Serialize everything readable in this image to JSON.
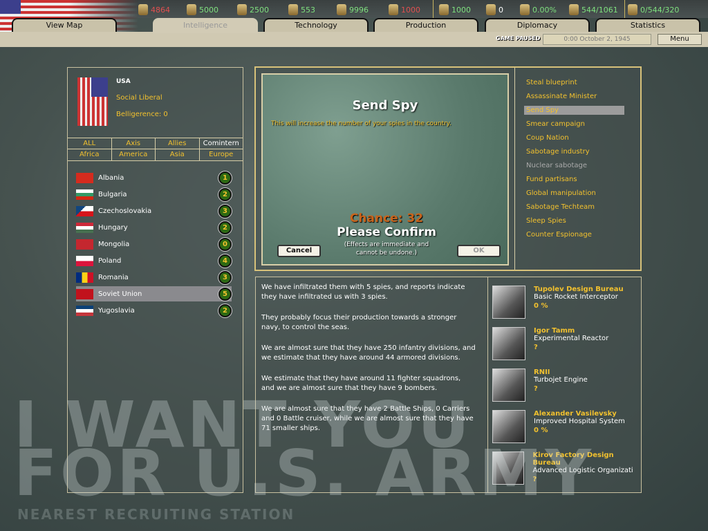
{
  "resources": [
    {
      "icon": "energy-icon",
      "value": "4864",
      "color": "#e05050"
    },
    {
      "icon": "metal-icon",
      "value": "5000",
      "color": "#7ee07e"
    },
    {
      "icon": "rare-materials-icon",
      "value": "2500",
      "color": "#7ee07e"
    },
    {
      "icon": "oil-icon",
      "value": "553",
      "color": "#7ee07e"
    },
    {
      "icon": "supplies-icon",
      "value": "9996",
      "color": "#7ee07e"
    },
    {
      "icon": "money-icon",
      "value": "1000",
      "color": "#e05050"
    },
    {
      "icon": "manpower-icon",
      "value": "1000",
      "color": "#7ee07e"
    },
    {
      "icon": "transports-icon",
      "value": "0",
      "color": "#ffffff"
    },
    {
      "icon": "dissent-icon",
      "value": "0.00%",
      "color": "#7ee07e"
    },
    {
      "icon": "convoys-icon",
      "value": "544/1061",
      "color": "#7ee07e"
    },
    {
      "icon": "ic-icon",
      "value": "0/544/320",
      "color": "#7ee07e"
    }
  ],
  "tabs": [
    "View Map",
    "Intelligence",
    "Technology",
    "Production",
    "Diplomacy",
    "Statistics"
  ],
  "active_tab": "Intelligence",
  "status": {
    "paused": "GAME PAUSED",
    "date": "0:00 October 2, 1945",
    "menu": "Menu"
  },
  "player": {
    "name": "USA",
    "ideology": "Social Liberal",
    "belligerence": "Belligerence: 0"
  },
  "filters": [
    [
      "ALL",
      "Axis",
      "Allies",
      "Comintern"
    ],
    [
      "Africa",
      "America",
      "Asia",
      "Europe"
    ]
  ],
  "countries": [
    {
      "name": "Albania",
      "spies": "1"
    },
    {
      "name": "Bulgaria",
      "spies": "2"
    },
    {
      "name": "Czechoslovakia",
      "spies": "3"
    },
    {
      "name": "Hungary",
      "spies": "2"
    },
    {
      "name": "Mongolia",
      "spies": "0"
    },
    {
      "name": "Poland",
      "spies": "4"
    },
    {
      "name": "Romania",
      "spies": "3"
    },
    {
      "name": "Soviet Union",
      "spies": "5"
    },
    {
      "name": "Yugoslavia",
      "spies": "2"
    }
  ],
  "dialog": {
    "title": "Send Spy",
    "description": "This will increase the number of your spies in the country.",
    "chance": "Chance: 32",
    "confirm": "Please Confirm",
    "note1": "(Effects are immediate and",
    "note2": "cannot be undone.)",
    "cancel": "Cancel",
    "ok": "OK"
  },
  "missions": [
    "Steal blueprint",
    "Assassinate Minister",
    "Send Spy",
    "Smear campaign",
    "Coup Nation",
    "Sabotage industry",
    "Nuclear sabotage",
    "Fund partisans",
    "Global manipulation",
    "Sabotage Techteam",
    "Sleep Spies",
    "Counter Espionage"
  ],
  "report": [
    "We have infiltrated them with 5 spies, and reports indicate they have infiltrated us with 3 spies.",
    "They probably focus their production towards a stronger navy, to control the seas.",
    "We are almost sure that they have 250 infantry divisions, and we estimate that they have around  44 armored divisions.",
    "We estimate that they have around  11 fighter squadrons, and we are almost sure that they have 9 bombers.",
    "We are almost sure that they have 2 Battle Ships, 0 Carriers and 0 Battle cruiser, while we are almost sure that they have 71 smaller ships."
  ],
  "techteams": [
    {
      "name": "Tupolev Design Bureau",
      "project": "Basic Rocket Interceptor",
      "progress": "0 %"
    },
    {
      "name": "Igor Tamm",
      "project": "Experimental Reactor",
      "progress": "?"
    },
    {
      "name": "RNII",
      "project": "Turbojet Engine",
      "progress": "?"
    },
    {
      "name": "Alexander Vasilevsky",
      "project": "Improved Hospital System",
      "progress": "0 %"
    },
    {
      "name": "Kirov Factory Design Bureau",
      "project": "Advanced Logistic Organizati",
      "progress": "?"
    }
  ],
  "background": {
    "poster1": "I WANT YOU",
    "poster2": "FOR U.S. ARMY",
    "poster3": "NEAREST RECRUITING STATION"
  }
}
